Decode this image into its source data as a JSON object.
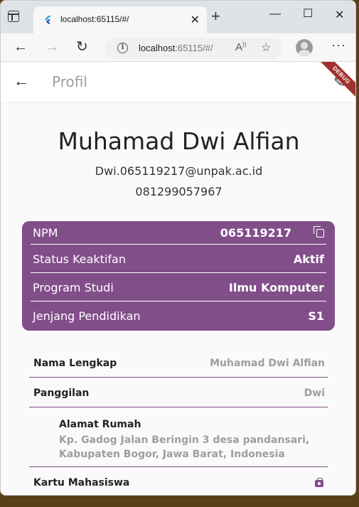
{
  "browser": {
    "tab_title": "localhost:65115/#/",
    "url_host": "localhost",
    "url_rest": ":65115/#/"
  },
  "appbar": {
    "title": "Profil",
    "debug_banner": "DEBUG"
  },
  "profile": {
    "name": "Muhamad Dwi Alfian",
    "email": "Dwi.065119217@unpak.ac.id",
    "phone": "081299057967"
  },
  "card": {
    "rows": [
      {
        "label": "NPM",
        "value": "065119217"
      },
      {
        "label": "Status Keaktifan",
        "value": "Aktif"
      },
      {
        "label": "Program Studi",
        "value": "Ilmu Komputer"
      },
      {
        "label": "Jenjang Pendidikan",
        "value": "S1"
      }
    ]
  },
  "details": {
    "full_name_label": "Nama Lengkap",
    "full_name_value": "Muhamad Dwi Alfian",
    "nickname_label": "Panggilan",
    "nickname_value": "Dwi",
    "address_label": "Alamat Rumah",
    "address_value": "Kp. Gadog Jalan Beringin 3 desa pandansari, Kabupaten Bogor, Jawa Barat, Indonesia",
    "student_card_label": "Kartu Mahasiswa"
  },
  "colors": {
    "accent": "#824e8a",
    "debug": "#a33030"
  },
  "icons": [
    "tab-actions-icon",
    "flutter-favicon",
    "close-icon",
    "plus-icon",
    "minimize-icon",
    "maximize-icon",
    "back-icon",
    "forward-icon",
    "refresh-icon",
    "info-icon",
    "read-aloud-icon",
    "add-favorite-icon",
    "profile-avatar",
    "more-icon",
    "arrow-back-icon",
    "edit-icon",
    "copy-icon",
    "badge-icon"
  ]
}
